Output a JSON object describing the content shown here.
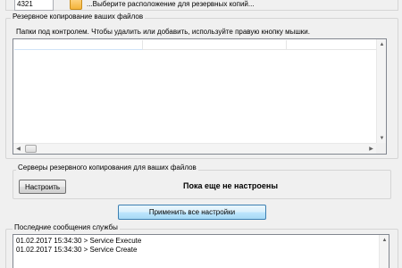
{
  "top": {
    "port_value": "4321",
    "path_label": "...Выберите расположение для резервных копий..."
  },
  "backup_files": {
    "group_title": "Резервное копирование ваших файлов",
    "hint": "Папки под контролем. Чтобы удалить или добавить, используйте правую кнопку мышки.",
    "columns": [
      "",
      ""
    ]
  },
  "servers": {
    "group_title": "Серверы резервного копирования для ваших файлов",
    "configure_button": "Настроить",
    "status": "Пока еще не настроены"
  },
  "apply_button": "Применить все настройки",
  "log": {
    "group_title": "Последние сообщения службы",
    "lines": [
      "01.02.2017 15:34:30 > Service Execute",
      "01.02.2017 15:34:30 > Service Create"
    ]
  },
  "icons": {
    "folder": "folder-icon",
    "scroll_up": "chevron-up-icon",
    "scroll_down": "chevron-down-icon",
    "scroll_left": "chevron-left-icon",
    "scroll_right": "chevron-right-icon"
  },
  "colors": {
    "window_bg": "#f0f0f0",
    "apply_border": "#3c7fb1",
    "folder": "#f4b33a"
  }
}
